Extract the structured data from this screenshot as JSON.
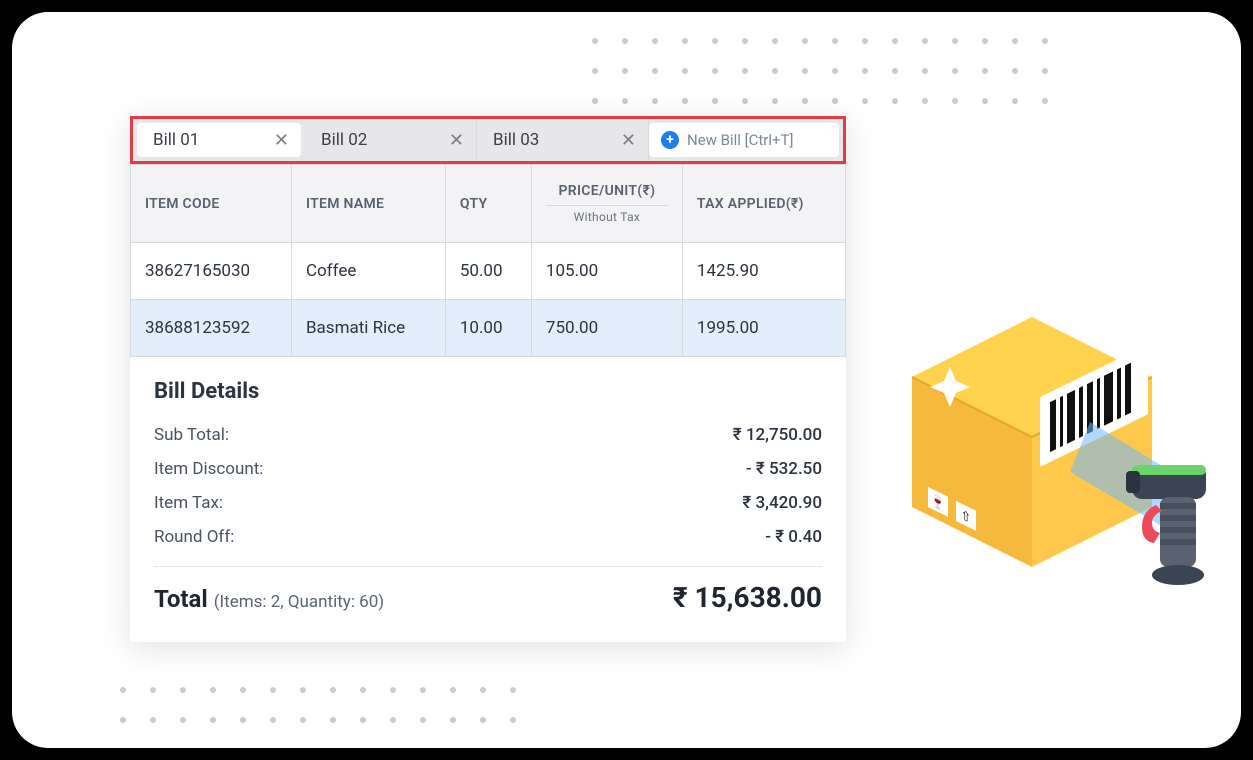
{
  "tabs": [
    {
      "label": "Bill 01",
      "active": true
    },
    {
      "label": "Bill 02",
      "active": false
    },
    {
      "label": "Bill 03",
      "active": false
    }
  ],
  "new_bill_label": "New Bill [Ctrl+T]",
  "columns": {
    "code": "ITEM CODE",
    "name": "ITEM NAME",
    "qty": "QTY",
    "price": "PRICE/UNIT(₹)",
    "price_sub": "Without Tax",
    "tax": "TAX APPLIED(₹)"
  },
  "rows": [
    {
      "code": "38627165030",
      "name": "Coffee",
      "qty": "50.00",
      "price": "105.00",
      "tax": "1425.90",
      "selected": false
    },
    {
      "code": "38688123592",
      "name": "Basmati Rice",
      "qty": "10.00",
      "price": "750.00",
      "tax": "1995.00",
      "selected": true
    }
  ],
  "details": {
    "heading": "Bill Details",
    "sub_total_label": "Sub Total:",
    "sub_total": "₹ 12,750.00",
    "discount_label": "Item Discount:",
    "discount": "- ₹ 532.50",
    "tax_label": "Item Tax:",
    "tax": "₹ 3,420.90",
    "round_label": "Round Off:",
    "round": "- ₹ 0.40",
    "total_label": "Total",
    "total_meta": "(Items: 2, Quantity: 60)",
    "total": "₹ 15,638.00"
  }
}
